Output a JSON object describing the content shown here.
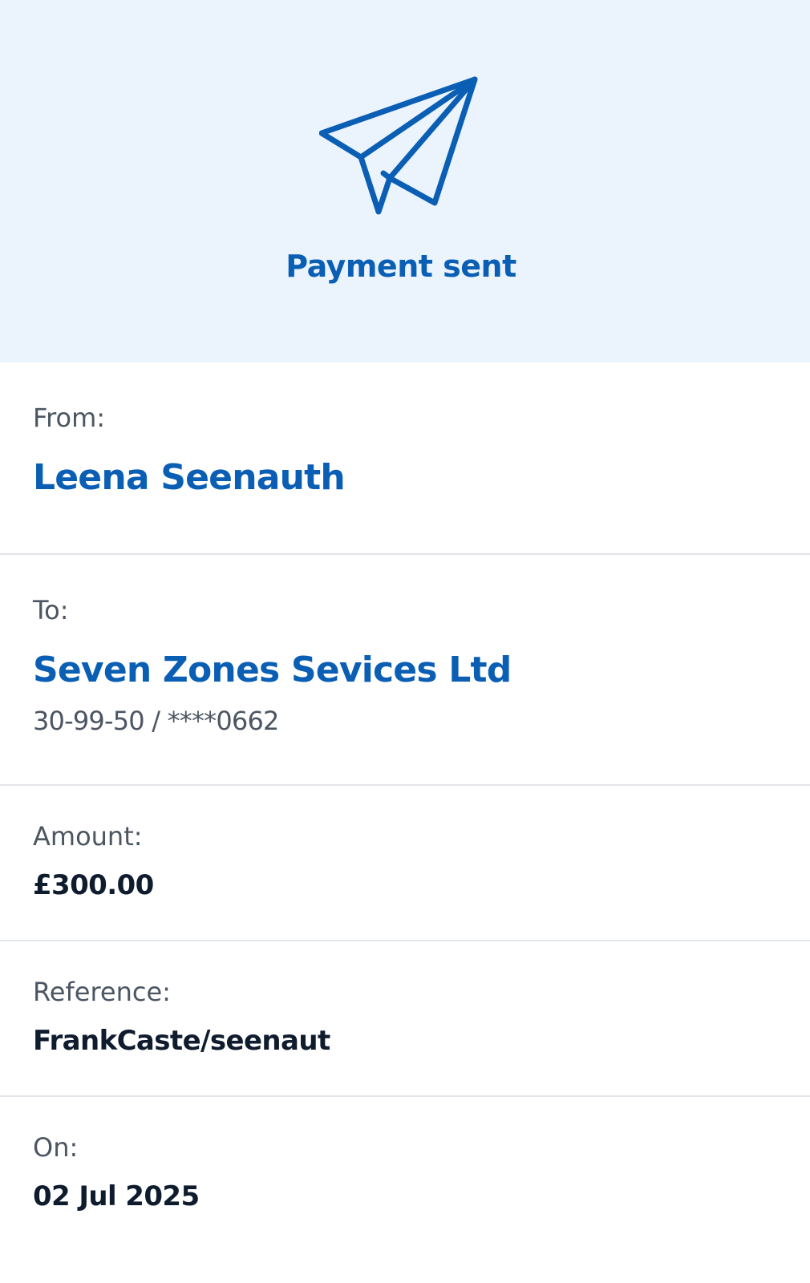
{
  "header": {
    "title": "Payment sent",
    "icon": "paper-plane-icon"
  },
  "colors": {
    "accent": "#0a5eb4",
    "hero_background": "#ebf4fd",
    "label": "#4c5662",
    "value": "#0f1c2e",
    "divider": "#e2e5e9"
  },
  "details": {
    "from": {
      "label": "From:",
      "name": "Leena Seenauth"
    },
    "to": {
      "label": "To:",
      "name": "Seven Zones Sevices Ltd",
      "account": "30-99-50 / ****0662"
    },
    "amount": {
      "label": "Amount:",
      "value": "£300.00"
    },
    "reference": {
      "label": "Reference:",
      "value": "FrankCaste/seenaut"
    },
    "date": {
      "label": "On:",
      "value": "02 Jul 2025"
    }
  }
}
